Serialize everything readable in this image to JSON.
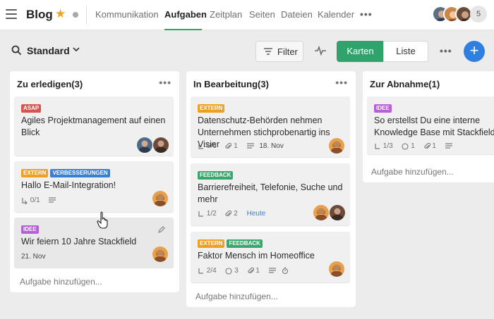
{
  "app": {
    "title": "Blog"
  },
  "nav": {
    "tabs": [
      "Kommunikation",
      "Aufgaben",
      "Zeitplan",
      "Seiten",
      "Dateien",
      "Kalender"
    ],
    "active": "Aufgaben",
    "more": "•••",
    "member_count": "5"
  },
  "toolbar": {
    "view_title": "Standard",
    "filter_label": "Filter",
    "view_cards": "Karten",
    "view_list": "Liste",
    "more": "•••",
    "add": "+"
  },
  "colors": {
    "accent": "#2fa36b",
    "primary": "#2f7fe0",
    "tag_asap": "#d9534f",
    "tag_extern": "#f0a020",
    "tag_verbesserungen": "#3a7fd6",
    "tag_idee": "#b75fd6",
    "tag_feedback": "#3aa76d"
  },
  "columns": [
    {
      "title": "Zu erledigen(3)",
      "more": "•••",
      "add_task": "Aufgabe hinzufügen...",
      "cards": [
        {
          "tags": [
            "ASAP"
          ],
          "title": "Agiles Projektmanagement auf einen Blick"
        },
        {
          "tags": [
            "EXTERN",
            "VERBESSERUNGEN"
          ],
          "title": "Hallo E-Mail-Integration!",
          "subtasks": "0/1"
        },
        {
          "tags": [
            "IDEE"
          ],
          "title": "Wir feiern 10 Jahre Stackfield",
          "date": "21. Nov"
        }
      ]
    },
    {
      "title": "In Bearbeitung(3)",
      "more": "•••",
      "add_task": "Aufgabe hinzufügen...",
      "cards": [
        {
          "tags": [
            "EXTERN"
          ],
          "title": "Datenschutz-Behörden nehmen Unternehmen stichprobenartig ins Visier",
          "subtasks": "6/6",
          "attachments": "1",
          "date": "18. Nov"
        },
        {
          "tags": [
            "FEEDBACK"
          ],
          "title": "Barrierefreiheit, Telefonie, Suche und mehr",
          "subtasks": "1/2",
          "attachments": "2",
          "date": "Heute"
        },
        {
          "tags": [
            "EXTERN",
            "FEEDBACK"
          ],
          "title": "Faktor Mensch im Homeoffice",
          "subtasks": "2/4",
          "comments": "3",
          "attachments": "1"
        }
      ]
    },
    {
      "title": "Zur Abnahme(1)",
      "add_task": "Aufgabe hinzufügen...",
      "cards": [
        {
          "tags": [
            "IDEE"
          ],
          "title": "So erstellst Du eine interne Knowledge Base mit Stackfield",
          "subtasks": "1/3",
          "comments": "1",
          "attachments": "1"
        }
      ]
    }
  ]
}
